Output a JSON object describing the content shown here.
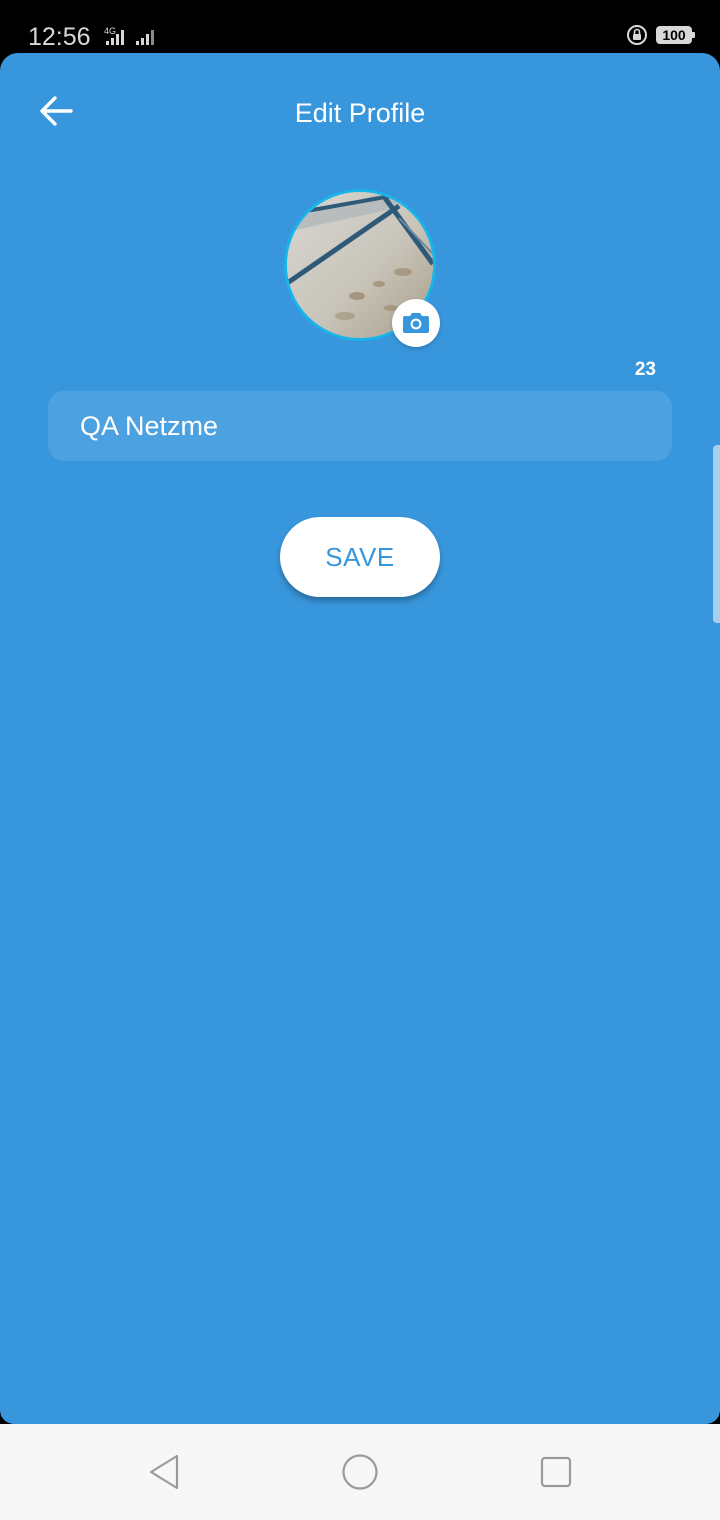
{
  "status_bar": {
    "time": "12:56",
    "network_type": "4G",
    "battery_level": "100",
    "icons": [
      "signal-icon",
      "signal-icon",
      "rotation-lock-icon",
      "battery-icon"
    ]
  },
  "header": {
    "title": "Edit Profile",
    "back_icon": "arrow-left-icon"
  },
  "profile": {
    "camera_icon": "camera-icon",
    "remaining_chars": "23",
    "name_value": "QA Netzme"
  },
  "actions": {
    "save_label": "SAVE"
  },
  "navigation": {
    "icons": [
      "back-triangle-icon",
      "home-circle-icon",
      "recents-square-icon"
    ]
  },
  "colors": {
    "primary": "#3896dc",
    "field_background": "#4ca2e0",
    "avatar_ring": "#19b4ea",
    "button_background": "#ffffff",
    "nav_background": "#f7f7f7"
  }
}
